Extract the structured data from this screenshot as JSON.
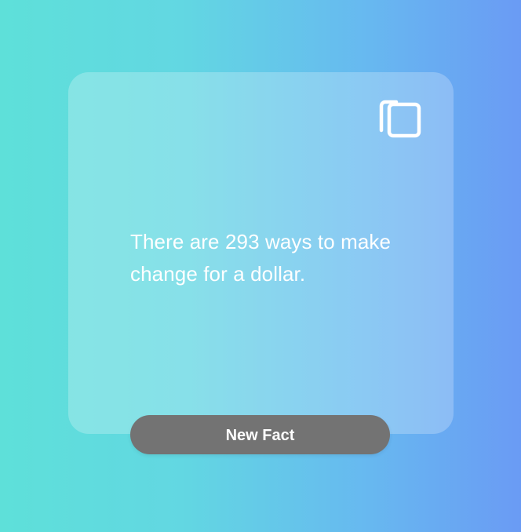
{
  "card": {
    "fact_text": "There are 293 ways to make change for a dollar.",
    "copy_icon": "copy-icon"
  },
  "actions": {
    "new_fact_label": "New Fact"
  },
  "colors": {
    "gradient_start": "#5ee0d9",
    "gradient_end": "#6a9bf4",
    "button_background": "#737373",
    "text": "#ffffff"
  }
}
